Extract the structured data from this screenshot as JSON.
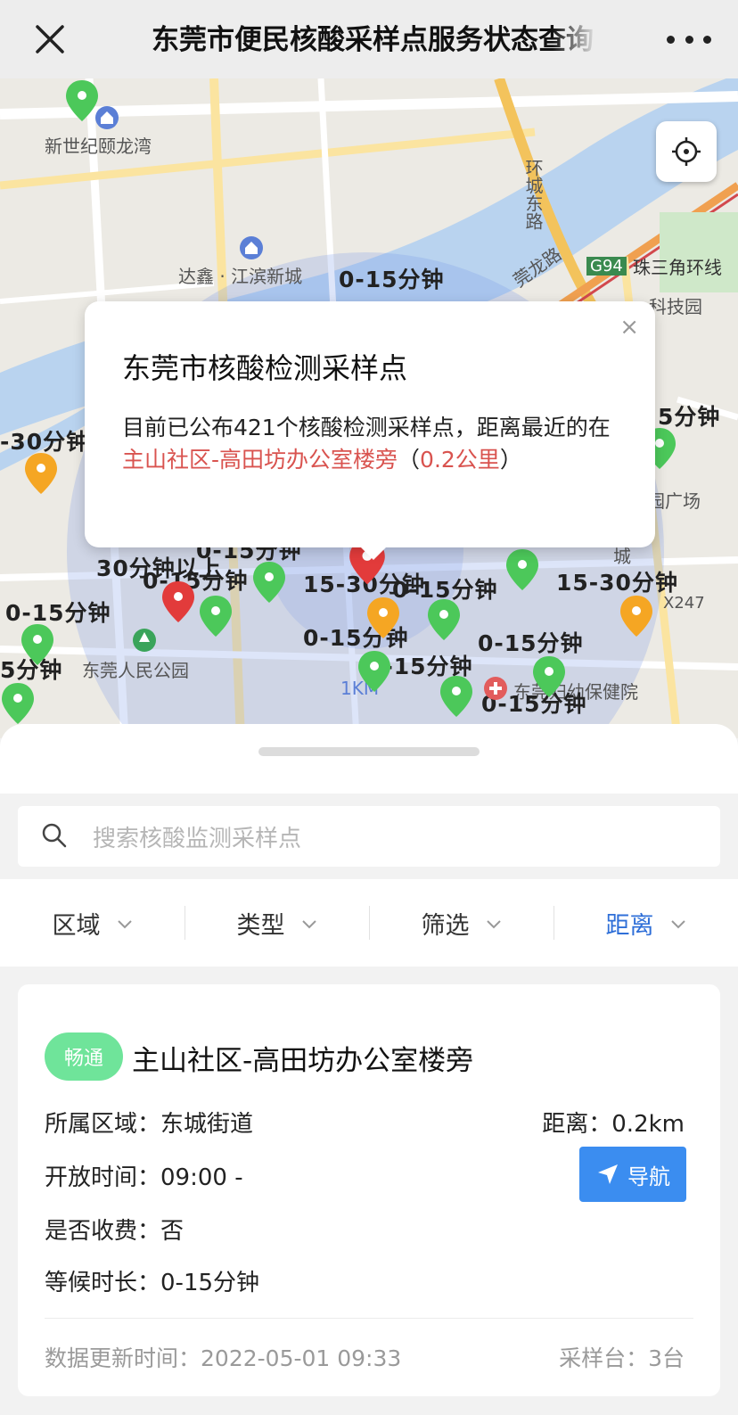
{
  "topbar": {
    "title": "东莞市便民核酸采样点服务状态查询"
  },
  "map": {
    "place_labels": [
      "新世纪颐龙湾",
      "达鑫 · 江滨新城",
      "环城东路",
      "珠三角环线",
      "科技园",
      "园广场",
      "东莞人民公园",
      "X247",
      "G94",
      "东莞妇幼保健院",
      "城",
      "莞龙路"
    ],
    "wait_labels": [
      "0-15分钟",
      "0-15分钟",
      "5分钟",
      "-30分钟",
      "30分钟以上",
      "0-15分钟",
      "15-30分钟",
      "0-15分钟",
      "0-15分钟",
      "0-15分钟",
      "15-30分钟",
      "0-15分钟",
      "0-15分钟",
      "5分钟",
      "0-15分钟"
    ],
    "scale_label": "1KM"
  },
  "popup": {
    "title": "东莞市核酸检测采样点",
    "text_before": "目前已公布421个核酸检测采样点，距离最近的在",
    "highlight_site": "主山社区-高田坊办公室楼旁",
    "paren_open": "（",
    "highlight_distance": "0.2公里",
    "paren_close": "）",
    "close_glyph": "×"
  },
  "search": {
    "placeholder": "搜索核酸监测采样点"
  },
  "filters": [
    {
      "label": "区域",
      "active": false
    },
    {
      "label": "类型",
      "active": false
    },
    {
      "label": "筛选",
      "active": false
    },
    {
      "label": "距离",
      "active": true
    }
  ],
  "card": {
    "status": "畅通",
    "name": "主山社区-高田坊办公室楼旁",
    "area_key": "所属区域：",
    "area_value": "东城街道",
    "hours_key": "开放时间：",
    "hours_value": "09:00 -",
    "fee_key": "是否收费：",
    "fee_value": "否",
    "wait_key": "等候时长：",
    "wait_value": "0-15分钟",
    "distance_key": "距离：",
    "distance_value": "0.2km",
    "nav_label": "导航",
    "updated_key": "数据更新时间：",
    "updated_value": "2022-05-01 09:33",
    "stations_key": "采样台：",
    "stations_value": "3台"
  },
  "colors": {
    "accent_blue": "#2f6fd8",
    "nav_button": "#3b8df0",
    "status_green": "#6fe49a",
    "highlight_red": "#d9534f",
    "pin_green": "#4cc85a",
    "pin_orange": "#f5a623",
    "pin_red": "#e23b3b",
    "river": "#b9d3ef"
  }
}
